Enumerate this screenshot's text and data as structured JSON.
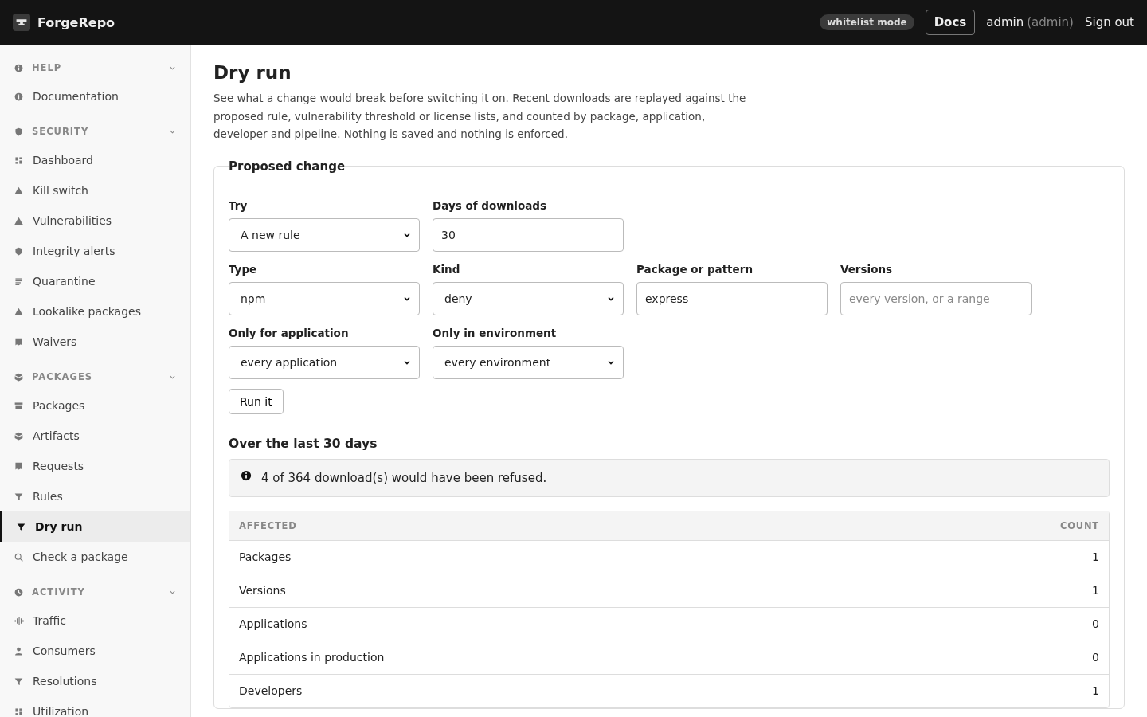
{
  "header": {
    "brand": "ForgeRepo",
    "mode_badge": "whitelist mode",
    "docs_button": "Docs",
    "user": "admin",
    "role": "(admin)",
    "sign_out": "Sign out"
  },
  "sidebar": {
    "sections": [
      {
        "title": "HELP",
        "expanded": true,
        "items": [
          {
            "label": "Documentation",
            "selected": false
          }
        ]
      },
      {
        "title": "SECURITY",
        "expanded": true,
        "items": [
          {
            "label": "Dashboard",
            "selected": false
          },
          {
            "label": "Kill switch",
            "selected": false
          },
          {
            "label": "Vulnerabilities",
            "selected": false
          },
          {
            "label": "Integrity alerts",
            "selected": false
          },
          {
            "label": "Quarantine",
            "selected": false
          },
          {
            "label": "Lookalike packages",
            "selected": false
          },
          {
            "label": "Waivers",
            "selected": false
          }
        ]
      },
      {
        "title": "PACKAGES",
        "expanded": true,
        "items": [
          {
            "label": "Packages",
            "selected": false
          },
          {
            "label": "Artifacts",
            "selected": false
          },
          {
            "label": "Requests",
            "selected": false
          },
          {
            "label": "Rules",
            "selected": false
          },
          {
            "label": "Dry run",
            "selected": true
          },
          {
            "label": "Check a package",
            "selected": false
          }
        ]
      },
      {
        "title": "ACTIVITY",
        "expanded": true,
        "items": [
          {
            "label": "Traffic",
            "selected": false
          },
          {
            "label": "Consumers",
            "selected": false
          },
          {
            "label": "Resolutions",
            "selected": false
          },
          {
            "label": "Utilization",
            "selected": false
          }
        ]
      }
    ]
  },
  "page": {
    "title": "Dry run",
    "description": "See what a change would break before switching it on. Recent downloads are replayed against the proposed rule, vulnerability threshold or license lists, and counted by package, application, developer and pipeline. Nothing is saved and nothing is enforced."
  },
  "form": {
    "legend": "Proposed change",
    "rows": [
      [
        {
          "label": "Try",
          "kind": "select",
          "value": "A new rule"
        },
        {
          "label": "Days of downloads",
          "kind": "input",
          "value": "30"
        }
      ],
      [
        {
          "label": "Type",
          "kind": "select",
          "value": "npm"
        },
        {
          "label": "Kind",
          "kind": "select",
          "value": "deny"
        },
        {
          "label": "Package or pattern",
          "kind": "input",
          "value": "express"
        },
        {
          "label": "Versions",
          "kind": "input",
          "placeholder": "every version, or a range"
        }
      ],
      [
        {
          "label": "Only for application",
          "kind": "select",
          "value": "every application"
        },
        {
          "label": "Only in environment",
          "kind": "select",
          "value": "every environment"
        }
      ]
    ],
    "submit": "Run it"
  },
  "results": {
    "heading": "Over the last 30 days",
    "notice": "4 of 364 download(s) would have been refused.",
    "columns": [
      "AFFECTED",
      "COUNT"
    ],
    "rows": [
      [
        "Packages",
        "1"
      ],
      [
        "Versions",
        "1"
      ],
      [
        "Applications",
        "0"
      ],
      [
        "Applications in production",
        "0"
      ],
      [
        "Developers",
        "1"
      ]
    ]
  }
}
